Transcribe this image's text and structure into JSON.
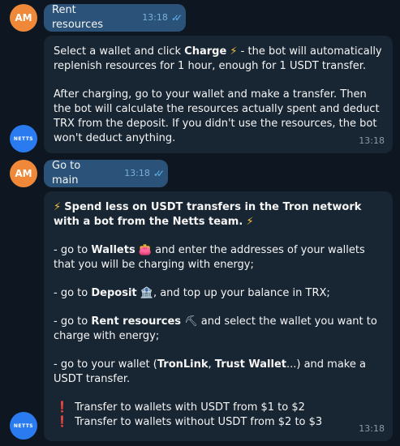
{
  "avatars": {
    "user_initials": "AM",
    "bot_label": "NETTS"
  },
  "msg1": {
    "text": "Rent resources",
    "time": "13:18"
  },
  "msg2": {
    "p1_pre": "Select a wallet and click ",
    "p1_bold": "Charge",
    "p1_post": " - the bot will automatically replenish resources for 1 hour, enough for 1 USDT transfer.",
    "p2": "After charging, go to your wallet and make a transfer. Then the bot will calculate the resources actually spent and deduct TRX from the deposit. If you didn't use the resources, the bot won't deduct anything.",
    "time": "13:18"
  },
  "msg3": {
    "text": "Go to main",
    "time": "13:18"
  },
  "msg4": {
    "headline": "Spend less on USDT transfers in the Tron network with a bot from the Netts team.",
    "wallets_pre": "- go to ",
    "wallets_bold": "Wallets",
    "wallets_post": " and enter the addresses of your wallets that you will be charging with energy;",
    "deposit_pre": "- go to ",
    "deposit_bold": "Deposit",
    "deposit_post": ", and top up your balance in TRX;",
    "rent_pre": "- go to ",
    "rent_bold": "Rent resources",
    "rent_post": "  and select the wallet you want to charge with energy;",
    "wallet_pre": "- go to your wallet (",
    "wallet_bold1": "TronLink",
    "wallet_sep": ", ",
    "wallet_bold2": "Trust Wallet",
    "wallet_post": "...) and make a USDT transfer.",
    "note1": "Transfer to wallets with USDT from $1 to $2",
    "note2": "Transfer to wallets without USDT from $2 to $3",
    "time": "13:18"
  },
  "icons": {
    "bolt": "⚡",
    "exclamation": "❗",
    "purse": "👛",
    "bank": "🏦",
    "pick": "⛏"
  }
}
